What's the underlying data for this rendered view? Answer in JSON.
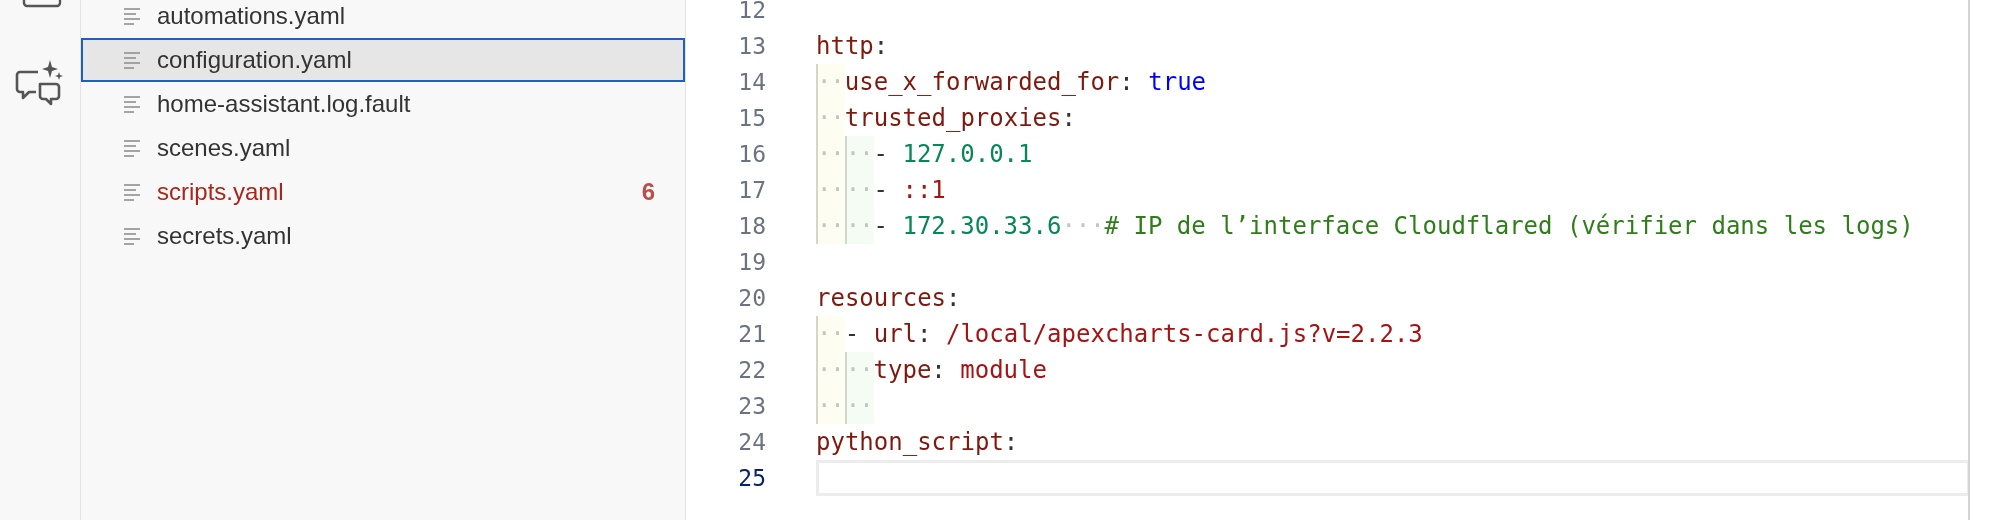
{
  "files": [
    {
      "name": "automations.yaml",
      "selected": false,
      "error": false
    },
    {
      "name": "configuration.yaml",
      "selected": true,
      "error": false
    },
    {
      "name": "home-assistant.log.fault",
      "selected": false,
      "error": false
    },
    {
      "name": "scenes.yaml",
      "selected": false,
      "error": false
    },
    {
      "name": "scripts.yaml",
      "selected": false,
      "error": true,
      "badge": "6"
    },
    {
      "name": "secrets.yaml",
      "selected": false,
      "error": false
    }
  ],
  "editor": {
    "lines": [
      {
        "number": "12",
        "current": false
      },
      {
        "number": "13",
        "current": false,
        "tokens": [
          {
            "kind": "key",
            "text": "http"
          },
          {
            "kind": "punct",
            "text": ":"
          }
        ]
      },
      {
        "number": "14",
        "current": false,
        "tokens": [
          {
            "kind": "space",
            "text": "··"
          },
          {
            "kind": "key",
            "text": "use_x_forwarded_for"
          },
          {
            "kind": "punct",
            "text": ": "
          },
          {
            "kind": "bool",
            "text": "true"
          }
        ]
      },
      {
        "number": "15",
        "current": false,
        "tokens": [
          {
            "kind": "space",
            "text": "··"
          },
          {
            "kind": "key",
            "text": "trusted_proxies"
          },
          {
            "kind": "punct",
            "text": ":"
          }
        ]
      },
      {
        "number": "16",
        "current": false,
        "tokens": [
          {
            "kind": "space",
            "text": "····"
          },
          {
            "kind": "punct",
            "text": "- "
          },
          {
            "kind": "number",
            "text": "127.0.0.1"
          }
        ]
      },
      {
        "number": "17",
        "current": false,
        "tokens": [
          {
            "kind": "space",
            "text": "····"
          },
          {
            "kind": "punct",
            "text": "- "
          },
          {
            "kind": "string",
            "text": "::1"
          }
        ]
      },
      {
        "number": "18",
        "current": false,
        "tokens": [
          {
            "kind": "space",
            "text": "····"
          },
          {
            "kind": "punct",
            "text": "- "
          },
          {
            "kind": "number",
            "text": "172.30.33.6"
          },
          {
            "kind": "space",
            "text": "···"
          },
          {
            "kind": "comment",
            "text": "# IP de l’interface Cloudflared (vérifier dans les logs)"
          }
        ]
      },
      {
        "number": "19",
        "current": false
      },
      {
        "number": "20",
        "current": false,
        "tokens": [
          {
            "kind": "key",
            "text": "resources"
          },
          {
            "kind": "punct",
            "text": ":"
          }
        ]
      },
      {
        "number": "21",
        "current": false,
        "tokens": [
          {
            "kind": "space",
            "text": "··"
          },
          {
            "kind": "punct",
            "text": "- "
          },
          {
            "kind": "key",
            "text": "url"
          },
          {
            "kind": "punct",
            "text": ": "
          },
          {
            "kind": "string",
            "text": "/local/apexcharts-card.js?v=2.2.3"
          }
        ]
      },
      {
        "number": "22",
        "current": false,
        "tokens": [
          {
            "kind": "space",
            "text": "····"
          },
          {
            "kind": "key",
            "text": "type"
          },
          {
            "kind": "punct",
            "text": ": "
          },
          {
            "kind": "string",
            "text": "module"
          }
        ]
      },
      {
        "number": "23",
        "current": false,
        "tokens": [
          {
            "kind": "space",
            "text": "····"
          }
        ]
      },
      {
        "number": "24",
        "current": false,
        "tokens": [
          {
            "kind": "key",
            "text": "python_script"
          },
          {
            "kind": "punct",
            "text": ":"
          }
        ]
      },
      {
        "number": "25",
        "current": true
      }
    ]
  }
}
